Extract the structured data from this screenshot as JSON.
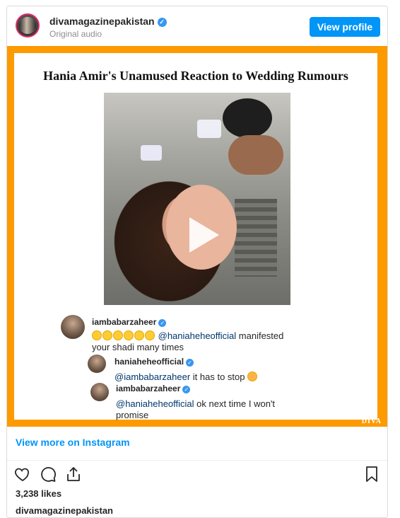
{
  "header": {
    "username": "divamagazinepakistan",
    "subtitle": "Original audio",
    "view_profile_label": "View profile"
  },
  "media": {
    "title": "Hania Amir's Unamused Reaction to Wedding Rumours",
    "watermark": "DIVA",
    "play_icon": "play-icon",
    "border_color": "#fd9a00",
    "comments": [
      {
        "username": "iambabarzaheer",
        "emoji_count": 6,
        "mention": "@haniaheheofficial",
        "text_after_mention": " manifested",
        "text_line2": "your shadi many times"
      },
      {
        "username": "haniaheheofficial",
        "mention": "@iambabarzaheer",
        "text_after_mention": " it has to stop"
      },
      {
        "username": "iambabarzaheer",
        "mention": "@haniaheheofficial",
        "text_after_mention": " ok next time I won't",
        "text_line2": "promise"
      }
    ]
  },
  "footer": {
    "view_more_label": "View more on Instagram",
    "likes_text": "3,238 likes",
    "owner": "divamagazinepakistan",
    "icons": [
      "heart-icon",
      "comment-icon",
      "share-icon",
      "bookmark-icon"
    ]
  },
  "colors": {
    "accent": "#0095f6",
    "verified": "#3897f0",
    "mention": "#00376b"
  }
}
